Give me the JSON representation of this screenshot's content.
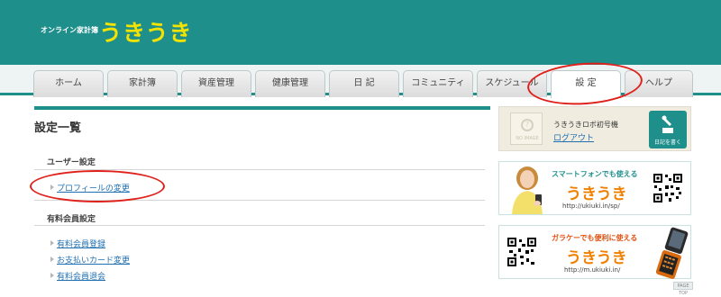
{
  "header": {
    "logo_sub": "オンライン家計簿",
    "logo_main": "うきうき"
  },
  "tabs": [
    {
      "label": "ホーム"
    },
    {
      "label": "家計簿"
    },
    {
      "label": "資産管理"
    },
    {
      "label": "健康管理"
    },
    {
      "label": "日 記"
    },
    {
      "label": "コミュニティ"
    },
    {
      "label": "スケジュール"
    },
    {
      "label": "設 定"
    },
    {
      "label": "ヘルプ"
    }
  ],
  "main": {
    "title": "設定一覧",
    "user_section": {
      "label": "ユーザー設定",
      "links": [
        "プロフィールの変更"
      ]
    },
    "paid_section": {
      "label": "有料会員設定",
      "links": [
        "有料会員登録",
        "お支払いカード変更",
        "有料会員退会"
      ]
    }
  },
  "sidebar": {
    "profile": {
      "noimage": "NO IMAGE",
      "username": "うきうきロボ初号機",
      "logout": "ログアウト",
      "diary_button": "日記を書く"
    },
    "sp_banner": {
      "headline": "スマートフォンでも使える",
      "logo": "うきうき",
      "url": "http://ukiuki.in/sp/"
    },
    "mobile_banner": {
      "headline": "ガラケーでも便利に使える",
      "logo": "うきうき",
      "url": "http://m.ukiuki.in/"
    }
  },
  "pagetop": "PAGE TOP",
  "colors": {
    "brand_teal": "#1f8f8c",
    "logo_yellow": "#f2e300",
    "link_blue": "#1f6fb1",
    "annotation_red": "#e0201a",
    "orange": "#f08000"
  }
}
